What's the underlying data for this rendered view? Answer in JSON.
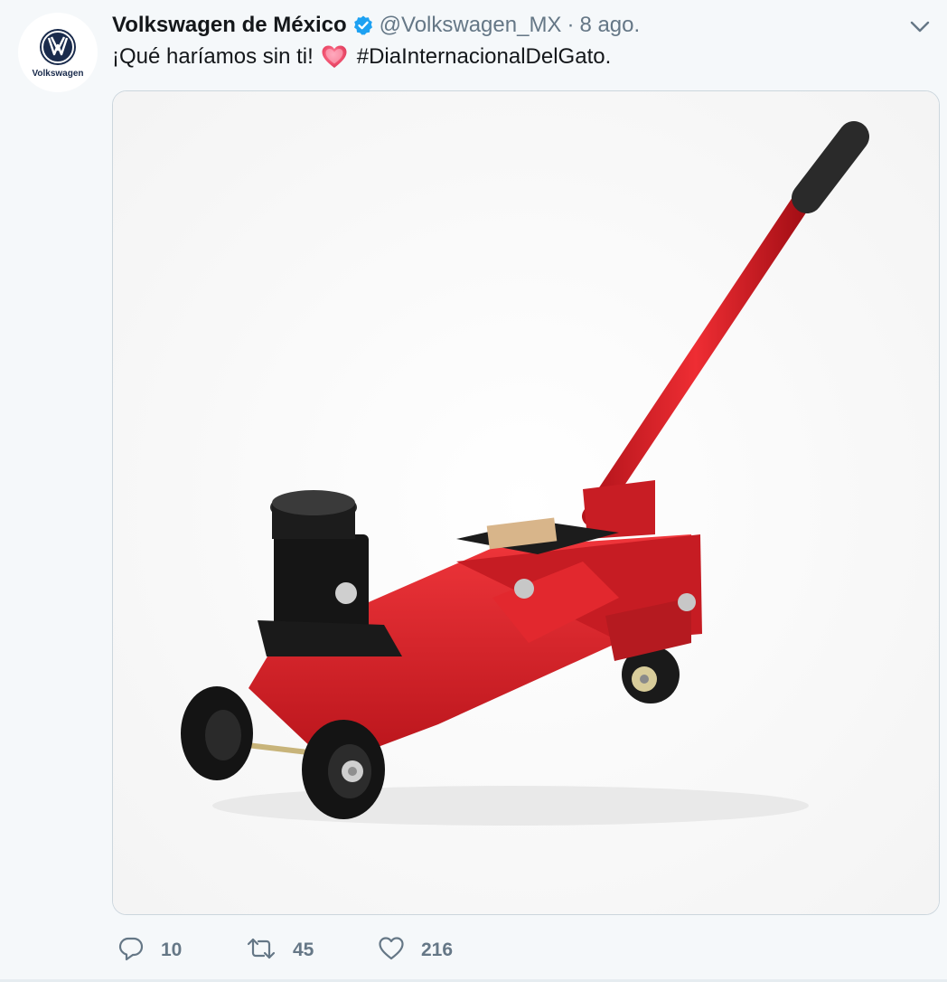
{
  "tweet": {
    "author": {
      "display_name": "Volkswagen de México",
      "handle": "@Volkswagen_MX",
      "avatar_label": "Volkswagen",
      "verified": true
    },
    "separator": "·",
    "date": "8 ago.",
    "text": {
      "prefix": "¡Qué haríamos sin ti!",
      "emoji": "heart-emoji",
      "hashtag": "#DiaInternacionalDelGato."
    },
    "media": {
      "subject": "red-hydraulic-floor-jack"
    },
    "actions": {
      "reply_count": "10",
      "retweet_count": "45",
      "like_count": "216"
    }
  },
  "colors": {
    "background": "#f5f8fa",
    "text_primary": "#14171a",
    "text_secondary": "#657786",
    "verified_blue": "#1da1f2",
    "vw_blue": "#1a2b4c",
    "jack_red": "#d9232a"
  },
  "icons": {
    "verified": "verified-badge-icon",
    "caret": "chevron-down-icon",
    "reply": "reply-icon",
    "retweet": "retweet-icon",
    "like": "heart-icon"
  }
}
